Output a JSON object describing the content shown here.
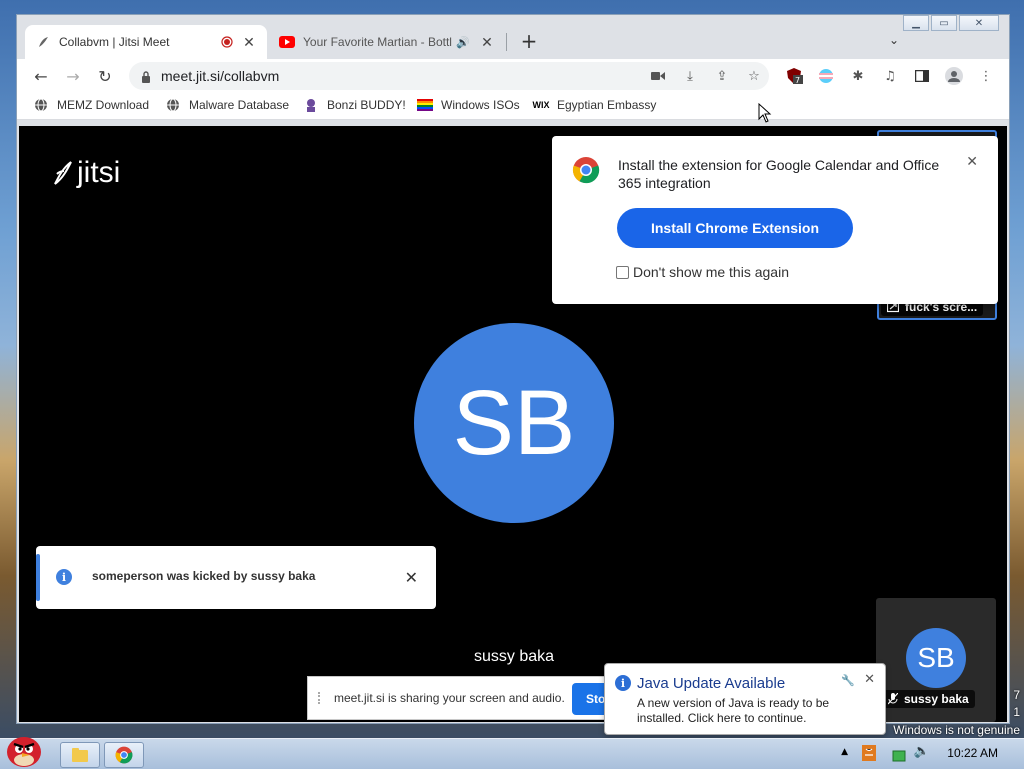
{
  "browser": {
    "tabs": [
      {
        "title": "Collabvm | Jitsi Meet",
        "active": true
      },
      {
        "title": "Your Favorite Martian - Bottl",
        "active": false
      }
    ],
    "url": "meet.jit.si/collabvm",
    "bookmarks": [
      {
        "label": "MEMZ Download",
        "icon": "globe-icon"
      },
      {
        "label": "Malware Database",
        "icon": "globe-icon"
      },
      {
        "label": "Bonzi BUDDY!",
        "icon": "bonzi-icon"
      },
      {
        "label": "Windows ISOs",
        "icon": "rainbow-flag-icon"
      },
      {
        "label": "Egyptian Embassy",
        "icon": "wix-icon"
      }
    ],
    "extension_badge": "7"
  },
  "meeting": {
    "logo_text": "jitsi",
    "main_avatar_initials": "SB",
    "main_speaker_name": "sussy baka",
    "top_thumb_label": "fuck's scre...",
    "bottom_thumb_initials": "SB",
    "bottom_thumb_name": "sussy baka"
  },
  "extension_popup": {
    "message": "Install the extension for Google Calendar and Office 365 integration",
    "install_label": "Install Chrome Extension",
    "dont_show_label": "Don't show me this again"
  },
  "notification": {
    "text": "someperson was kicked by sussy baka"
  },
  "share_bar": {
    "text": "meet.jit.si is sharing your screen and audio.",
    "stop_label": "Sto"
  },
  "java_balloon": {
    "title": "Java Update Available",
    "body": "A new version of Java is ready to be installed. Click here to continue."
  },
  "desktop": {
    "watermark": "Windows is not genuine",
    "clock": "10:22 AM",
    "partial_digit_1": "7",
    "partial_digit_2": "1"
  },
  "colors": {
    "accent_blue": "#3f80de",
    "install_button": "#1a65e8"
  }
}
